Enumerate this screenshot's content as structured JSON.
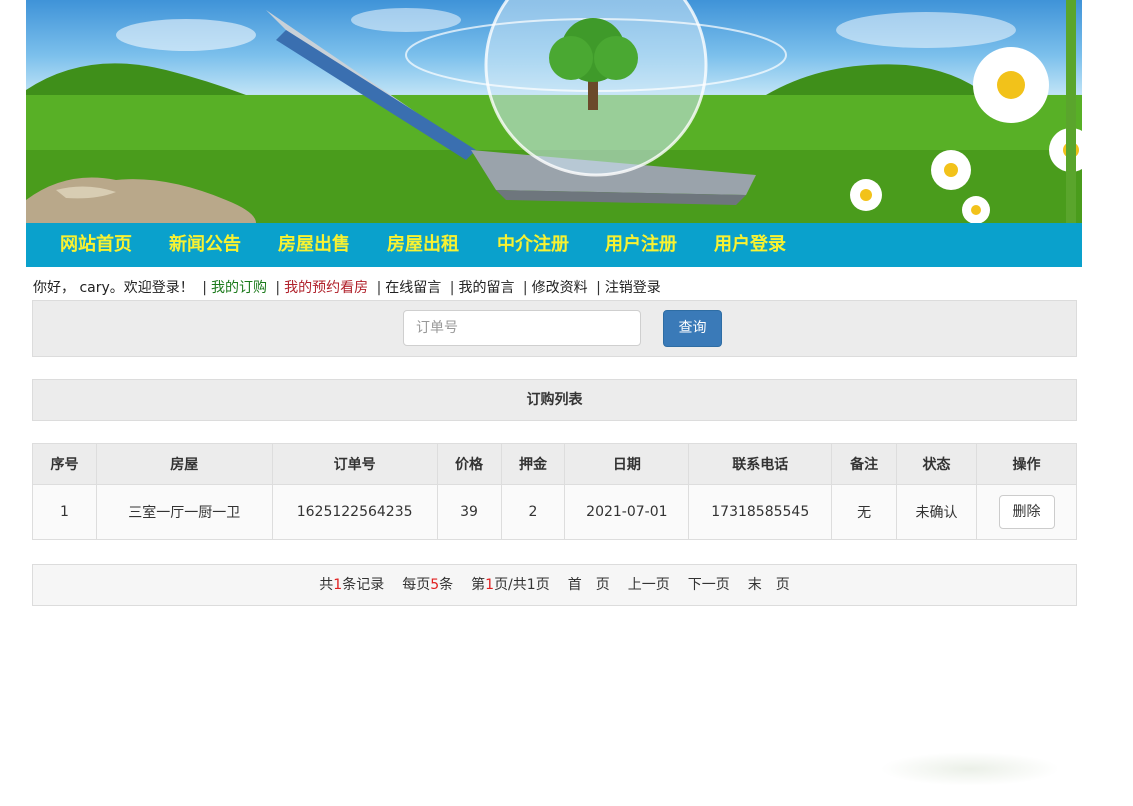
{
  "nav": {
    "items": [
      "网站首页",
      "新闻公告",
      "房屋出售",
      "房屋出租",
      "中介注册",
      "用户注册",
      "用户登录"
    ]
  },
  "userbar": {
    "greeting": "你好， cary。欢迎登录！",
    "links": [
      "我的订购",
      "我的预约看房",
      "在线留言",
      "我的留言",
      "修改资料",
      "注销登录"
    ]
  },
  "search": {
    "placeholder": "订单号",
    "button_label": "查询"
  },
  "list_title": "订购列表",
  "table": {
    "headers": [
      "序号",
      "房屋",
      "订单号",
      "价格",
      "押金",
      "日期",
      "联系电话",
      "备注",
      "状态",
      "操作"
    ],
    "rows": [
      {
        "index": "1",
        "house": "三室一厅一厨一卫",
        "order_no": "1625122564235",
        "price": "39",
        "deposit": "2",
        "date": "2021-07-01",
        "phone": "17318585545",
        "note": "无",
        "status": "未确认",
        "action": "删除"
      }
    ]
  },
  "pager": {
    "total_pre": "共",
    "total_count": "1",
    "total_post": "条记录",
    "per_pre": "每页",
    "per_count": "5",
    "per_post": "条",
    "page_pre": "第",
    "page_current": "1",
    "page_mid": "页/共",
    "page_total": "1",
    "page_post": "页",
    "first": "首　页",
    "prev": "上一页",
    "next": "下一页",
    "last": "末　页"
  },
  "colors": {
    "nav_bg": "#0aa1cc",
    "nav_text": "#f8f231",
    "primary_button": "#3a7ab8",
    "highlight_number": "#e02020"
  }
}
